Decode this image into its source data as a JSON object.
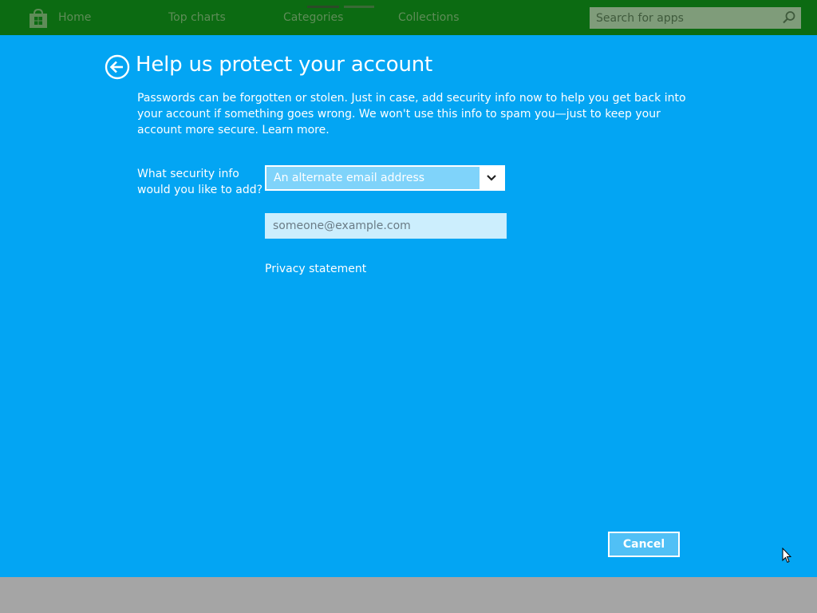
{
  "nav": {
    "items": [
      {
        "label": "Home"
      },
      {
        "label": "Top charts"
      },
      {
        "label": "Categories"
      },
      {
        "label": "Collections"
      }
    ],
    "search_placeholder": "Search for apps"
  },
  "dialog": {
    "title": "Help us protect your account",
    "description": "Passwords can be forgotten or stolen. Just in case, add security info now to help you get back into your account if something goes wrong. We won't use this info to spam you—just to keep your account more secure.",
    "learn_more": "Learn more.",
    "field_label": "What security info would you like to add?",
    "select_value": "An alternate email address",
    "email_placeholder": "someone@example.com",
    "privacy_link": "Privacy statement",
    "cancel_label": "Cancel"
  },
  "colors": {
    "nav_bg": "#0c6b12",
    "dialog_bg": "#03a5f3",
    "text": "#ffffff"
  }
}
